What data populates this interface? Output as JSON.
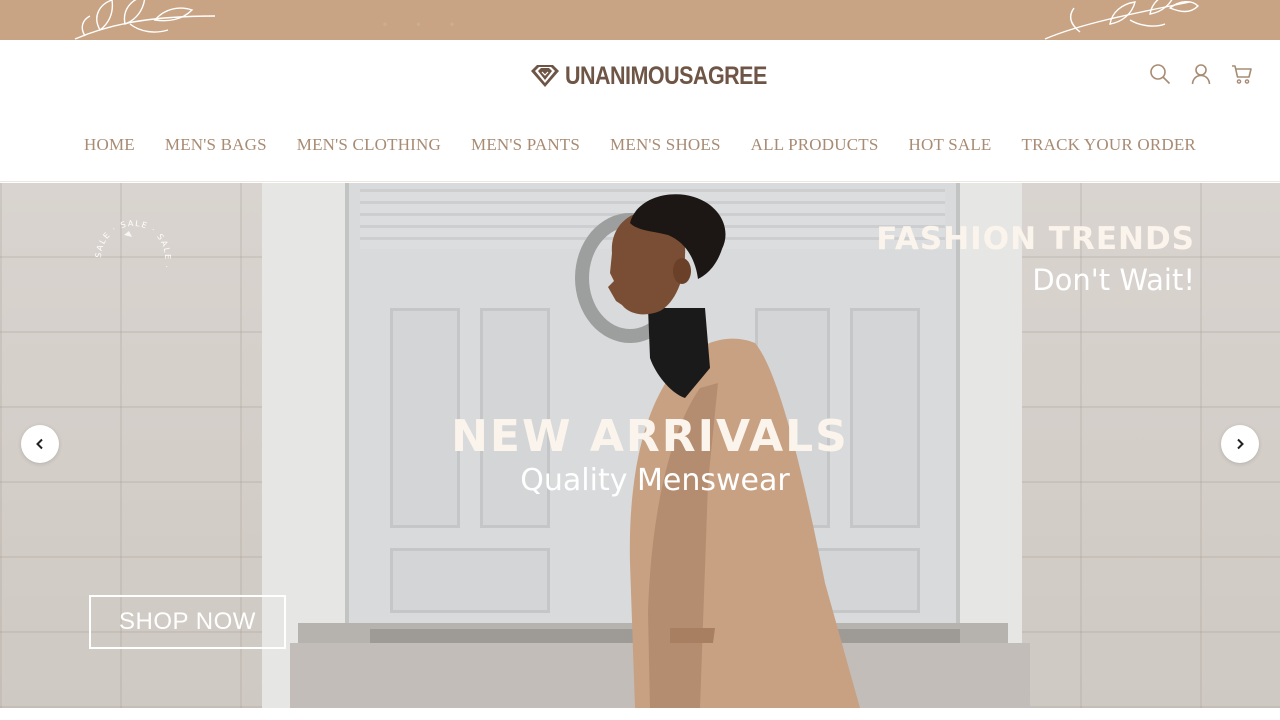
{
  "announcement": {
    "icon": "leaf-branch-icon"
  },
  "brand": {
    "name": "UNANIMOUSAGREE",
    "logo_icon": "diamond-logo-icon",
    "color": "#6e5545",
    "accent": "#c8a484"
  },
  "header_icons": [
    {
      "name": "search-icon",
      "label": "Search"
    },
    {
      "name": "account-icon",
      "label": "Account"
    },
    {
      "name": "cart-icon",
      "label": "Cart"
    }
  ],
  "nav": {
    "items": [
      {
        "label": "HOME"
      },
      {
        "label": "MEN'S BAGS"
      },
      {
        "label": "MEN'S CLOTHING"
      },
      {
        "label": "MEN'S PANTS"
      },
      {
        "label": "MEN'S SHOES"
      },
      {
        "label": "ALL PRODUCTS"
      },
      {
        "label": "HOT SALE"
      },
      {
        "label": "TRACK YOUR ORDER"
      }
    ]
  },
  "hero": {
    "badge_text": "SALE · SALE · SALE · ",
    "trend_title": "FASHION TRENDS",
    "trend_subtitle": "Don't Wait!",
    "headline": "NEW ARRIVALS",
    "subheadline": "Quality Menswear",
    "cta_label": "SHOP NOW",
    "prev_icon": "chevron-left-icon",
    "next_icon": "chevron-right-icon"
  }
}
